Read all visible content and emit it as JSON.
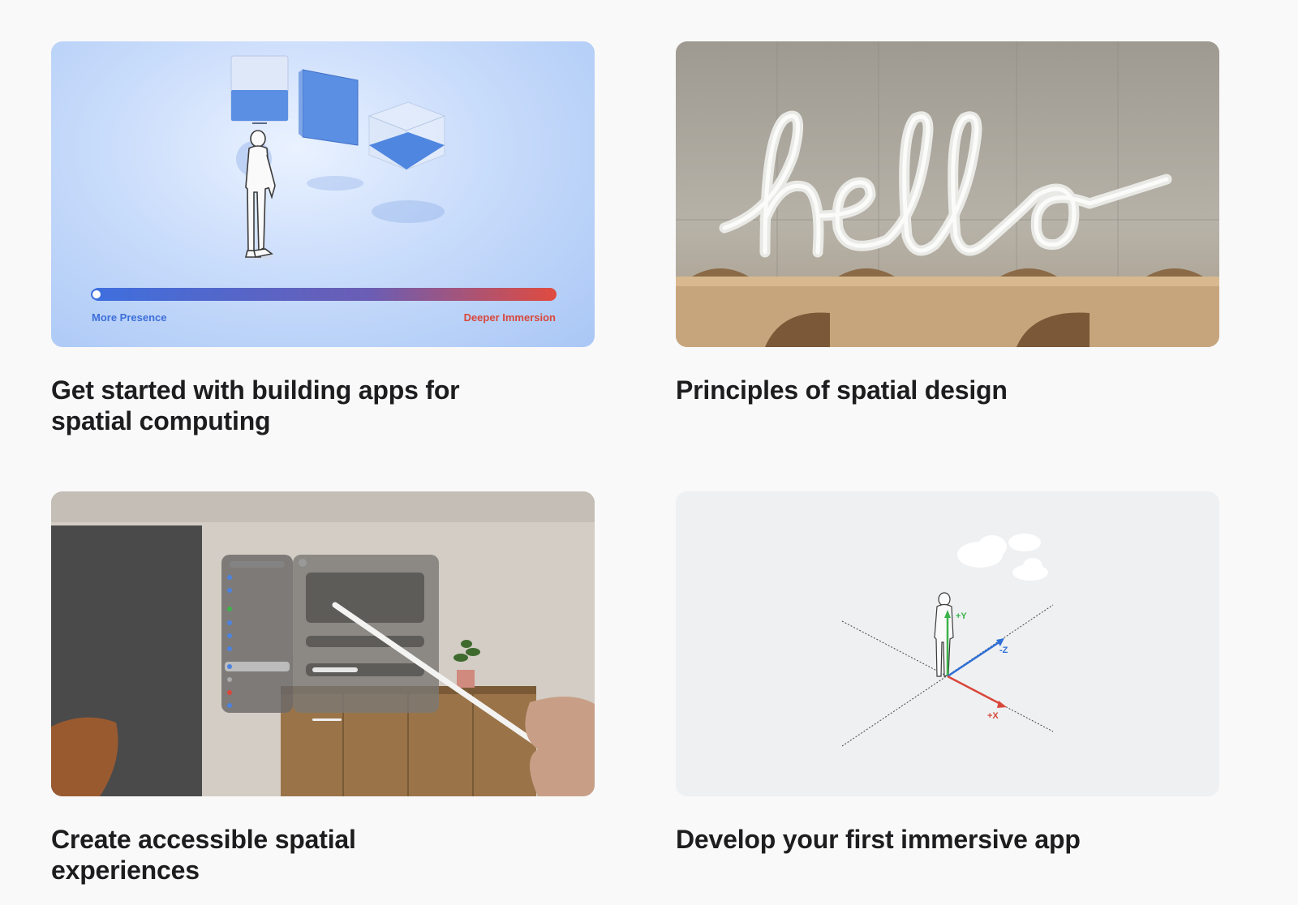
{
  "cards": [
    {
      "title": "Get started with building apps for spatial computing",
      "image": {
        "slider_left_label": "More Presence",
        "slider_right_label": "Deeper Immersion",
        "slider_value": 0
      }
    },
    {
      "title": "Principles of spatial design",
      "image": {
        "sign_text": "hello"
      }
    },
    {
      "title": "Create accessible spatial experiences",
      "image": {}
    },
    {
      "title": "Develop your first immersive app",
      "image": {
        "axis_y": "+Y",
        "axis_z": "-Z",
        "axis_x": "+X"
      }
    }
  ],
  "colors": {
    "presence_blue": "#3d6fd9",
    "immersion_red": "#d9473b",
    "axis_x": "#d9473b",
    "axis_y": "#3cb34a",
    "axis_z": "#2f6fd8"
  }
}
